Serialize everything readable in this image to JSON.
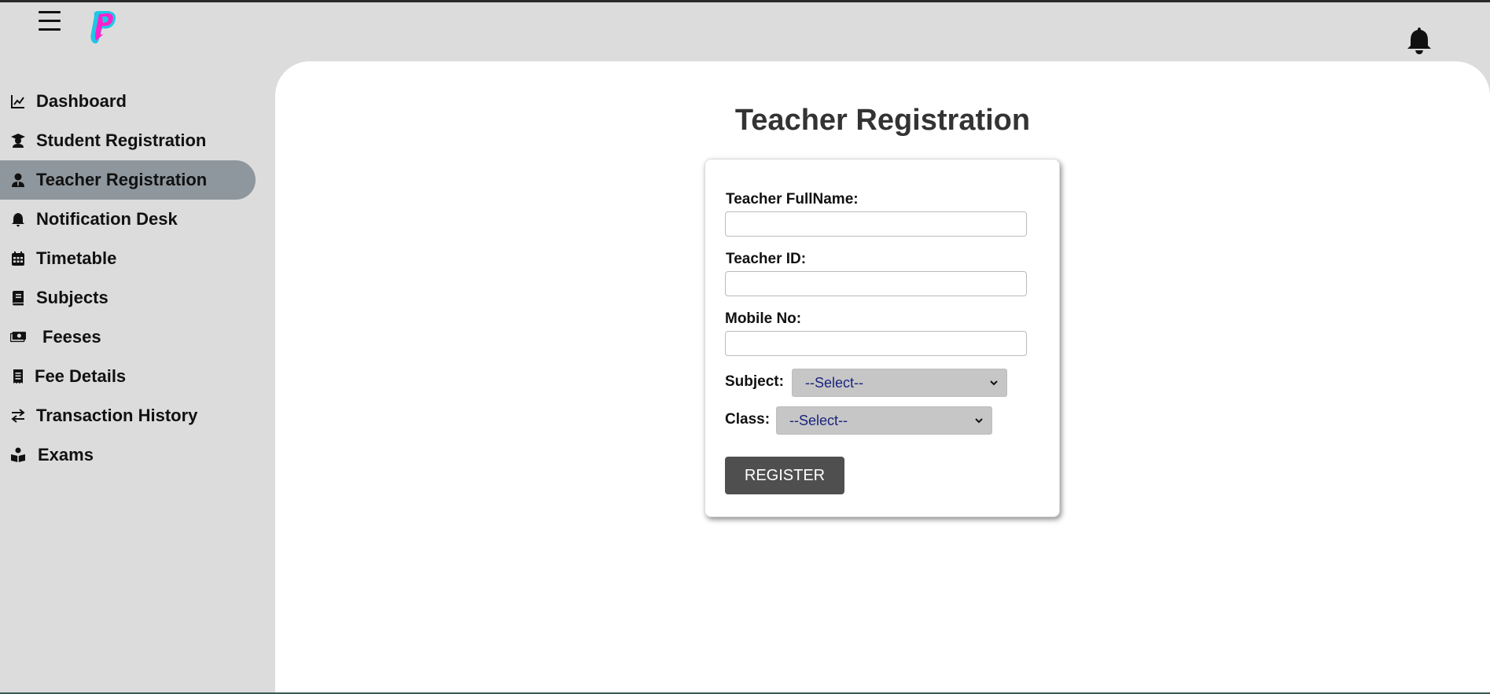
{
  "header": {
    "menu_icon": "hamburger-icon",
    "logo_icon": "app-logo",
    "bell_icon": "bell-icon"
  },
  "sidebar": {
    "items": [
      {
        "label": "Dashboard",
        "icon": "chart-line-icon"
      },
      {
        "label": "Student Registration",
        "icon": "graduate-icon"
      },
      {
        "label": "Teacher Registration",
        "icon": "user-tie-icon",
        "active": true
      },
      {
        "label": "Notification Desk",
        "icon": "bell-icon"
      },
      {
        "label": "Timetable",
        "icon": "calendar-icon"
      },
      {
        "label": "Subjects",
        "icon": "book-icon"
      },
      {
        "label": "Feeses",
        "icon": "money-bill-icon"
      },
      {
        "label": "Fee Details",
        "icon": "receipt-icon"
      },
      {
        "label": "Transaction History",
        "icon": "exchange-icon"
      },
      {
        "label": "Exams",
        "icon": "book-reader-icon"
      }
    ]
  },
  "main": {
    "title": "Teacher Registration",
    "form": {
      "fullname_label": "Teacher FullName:",
      "fullname_value": "",
      "id_label": "Teacher ID:",
      "id_value": "",
      "mobile_label": "Mobile No:",
      "mobile_value": "",
      "subject_label": "Subject:",
      "subject_selected": "--Select--",
      "class_label": "Class:",
      "class_selected": "--Select--",
      "register_label": "REGISTER"
    }
  },
  "colors": {
    "sidebar_bg": "#dcdcdc",
    "active_item": "#8f979e",
    "button_bg": "#4f4f4f",
    "select_bg": "#c6c6c6",
    "select_text": "#1a237e"
  }
}
